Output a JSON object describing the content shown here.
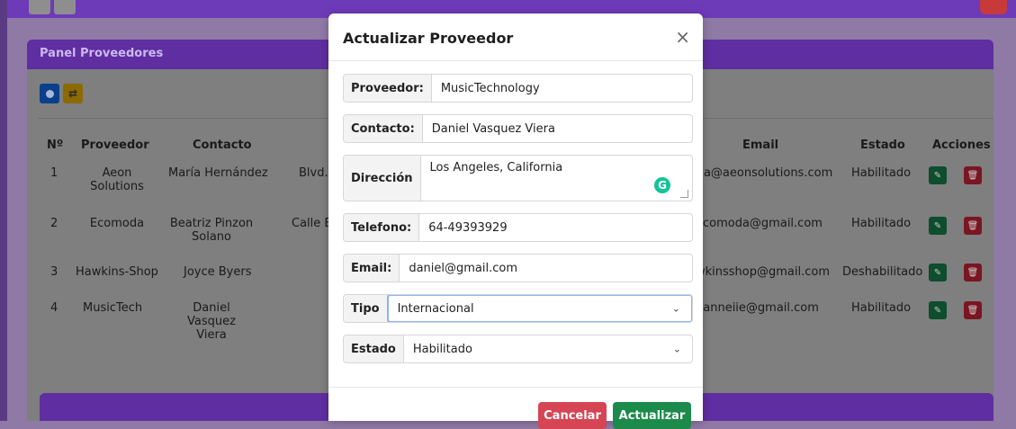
{
  "panel": {
    "title": "Panel Proveedores",
    "table": {
      "headers": [
        "Nº",
        "Proveedor",
        "Contacto",
        "Email",
        "Estado",
        "Acciones"
      ],
      "rows": [
        {
          "n": "1",
          "proveedor": "Aeon Solutions",
          "contacto": "María Hernández",
          "direccion": "Blvd.",
          "email": "ria@aeonsolutions.com",
          "estado": "Habilitado"
        },
        {
          "n": "2",
          "proveedor": "Ecomoda",
          "contacto": "Beatriz Pinzon Solano",
          "direccion": "Calle B",
          "email": "ecomoda@gmail.com",
          "estado": "Habilitado"
        },
        {
          "n": "3",
          "proveedor": "Hawkins-Shop",
          "contacto": "Joyce Byers",
          "direccion": "",
          "email": "wkinsshop@gmail.com",
          "estado": "Deshabilitado"
        },
        {
          "n": "4",
          "proveedor": "MusicTech",
          "contacto": "Daniel Vasquez Viera",
          "direccion": "",
          "email": "danneiie@gmail.com",
          "estado": "Habilitado"
        }
      ]
    }
  },
  "modal": {
    "title": "Actualizar Proveedor",
    "close_symbol": "×",
    "fields": {
      "proveedor": {
        "label": "Proveedor:",
        "value": "MusicTechnology"
      },
      "contacto": {
        "label": "Contacto:",
        "value": "Daniel Vasquez Viera"
      },
      "direccion": {
        "label": "Dirección",
        "value": "Los Angeles, California"
      },
      "telefono": {
        "label": "Telefono:",
        "value": "64-49393929"
      },
      "email": {
        "label": "Email:",
        "value": "daniel@gmail.com"
      },
      "tipo": {
        "label": "Tipo",
        "value": "Internacional"
      },
      "estado": {
        "label": "Estado",
        "value": "Habilitado"
      }
    },
    "buttons": {
      "cancel": "Cancelar",
      "update": "Actualizar"
    }
  },
  "icons": {
    "chevron": "⌄",
    "grammarly": "G",
    "edit": "✎",
    "delete": "🗑"
  }
}
